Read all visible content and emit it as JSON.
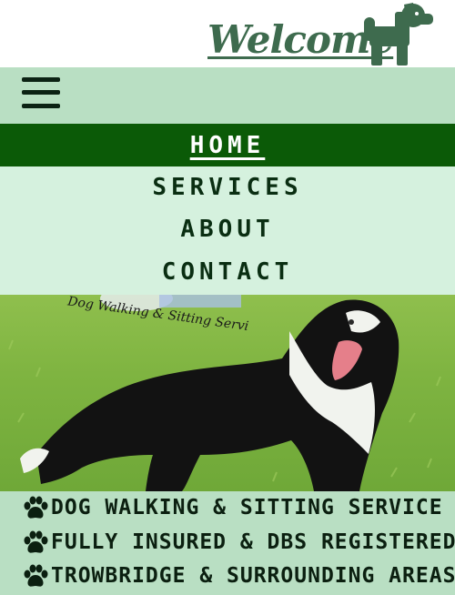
{
  "header": {
    "title": "Welcome",
    "logo_icon": "dog-icon",
    "colors": {
      "title": "#3e6b4e",
      "logo": "#3e6b4e"
    }
  },
  "menu": {
    "toggle_icon": "hamburger-menu-icon",
    "background": "#b9dfc3"
  },
  "nav": {
    "items": [
      {
        "label": "HOME",
        "active": true
      },
      {
        "label": "SERVICES",
        "active": false
      },
      {
        "label": "ABOUT",
        "active": false
      },
      {
        "label": "CONTACT",
        "active": false
      }
    ],
    "colors": {
      "active_bg": "#0b5a07",
      "bg": "#d5f1de",
      "text": "#0a2e12"
    }
  },
  "hero": {
    "image": "border-collie-on-grass",
    "overlay_text": "Dog Walking & Sitting Servi"
  },
  "features": {
    "icon": "paw-print-icon",
    "items": [
      "DOG WALKING & SITTING SERVICE",
      "FULLY INSURED & DBS REGISTERED",
      "TROWBRIDGE & SURROUNDING AREAS"
    ]
  }
}
